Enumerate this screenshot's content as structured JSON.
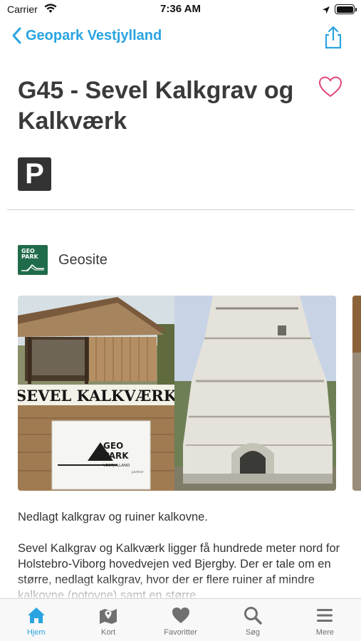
{
  "status_bar": {
    "carrier": "Carrier",
    "time": "7:36 AM"
  },
  "nav": {
    "back_label": "Geopark Vestjylland",
    "back_icon": "chevron-left-icon",
    "share_icon": "share-icon"
  },
  "header": {
    "title": "G45 - Sevel Kalkgrav og Kalkværk",
    "favorite_icon": "heart-outline-icon",
    "parking_label": "P"
  },
  "category": {
    "logo_text_1": "GEO",
    "logo_text_2": "PARK",
    "label": "Geosite"
  },
  "gallery": {
    "sign_text": "SEVEL KALKVÆRK",
    "geopark_text_1": "GEO",
    "geopark_text_2": "PARK",
    "geopark_sub": "VESTJYLLAND",
    "geopark_partner": "partner"
  },
  "description": {
    "short": "Nedlagt kalkgrav og ruiner kalkovne.",
    "long": "Sevel Kalkgrav og Kalkværk ligger få hundrede meter nord for Holstebro-Viborg hovedvejen ved Bjergby. Der er tale om en større, nedlagt kalkgrav, hvor der er flere ruiner af mindre kalkovne (potovne) samt en større"
  },
  "tabs": [
    {
      "label": "Hjem",
      "icon": "home-icon",
      "active": true
    },
    {
      "label": "Kort",
      "icon": "map-icon",
      "active": false
    },
    {
      "label": "Favoritter",
      "icon": "heart-icon",
      "active": false
    },
    {
      "label": "Søg",
      "icon": "search-icon",
      "active": false
    },
    {
      "label": "Mere",
      "icon": "menu-icon",
      "active": false
    }
  ],
  "colors": {
    "accent": "#2aa4e0",
    "favorite": "#e0457b",
    "inactive_tab": "#707070",
    "geopark_green": "#1f6b4a"
  }
}
